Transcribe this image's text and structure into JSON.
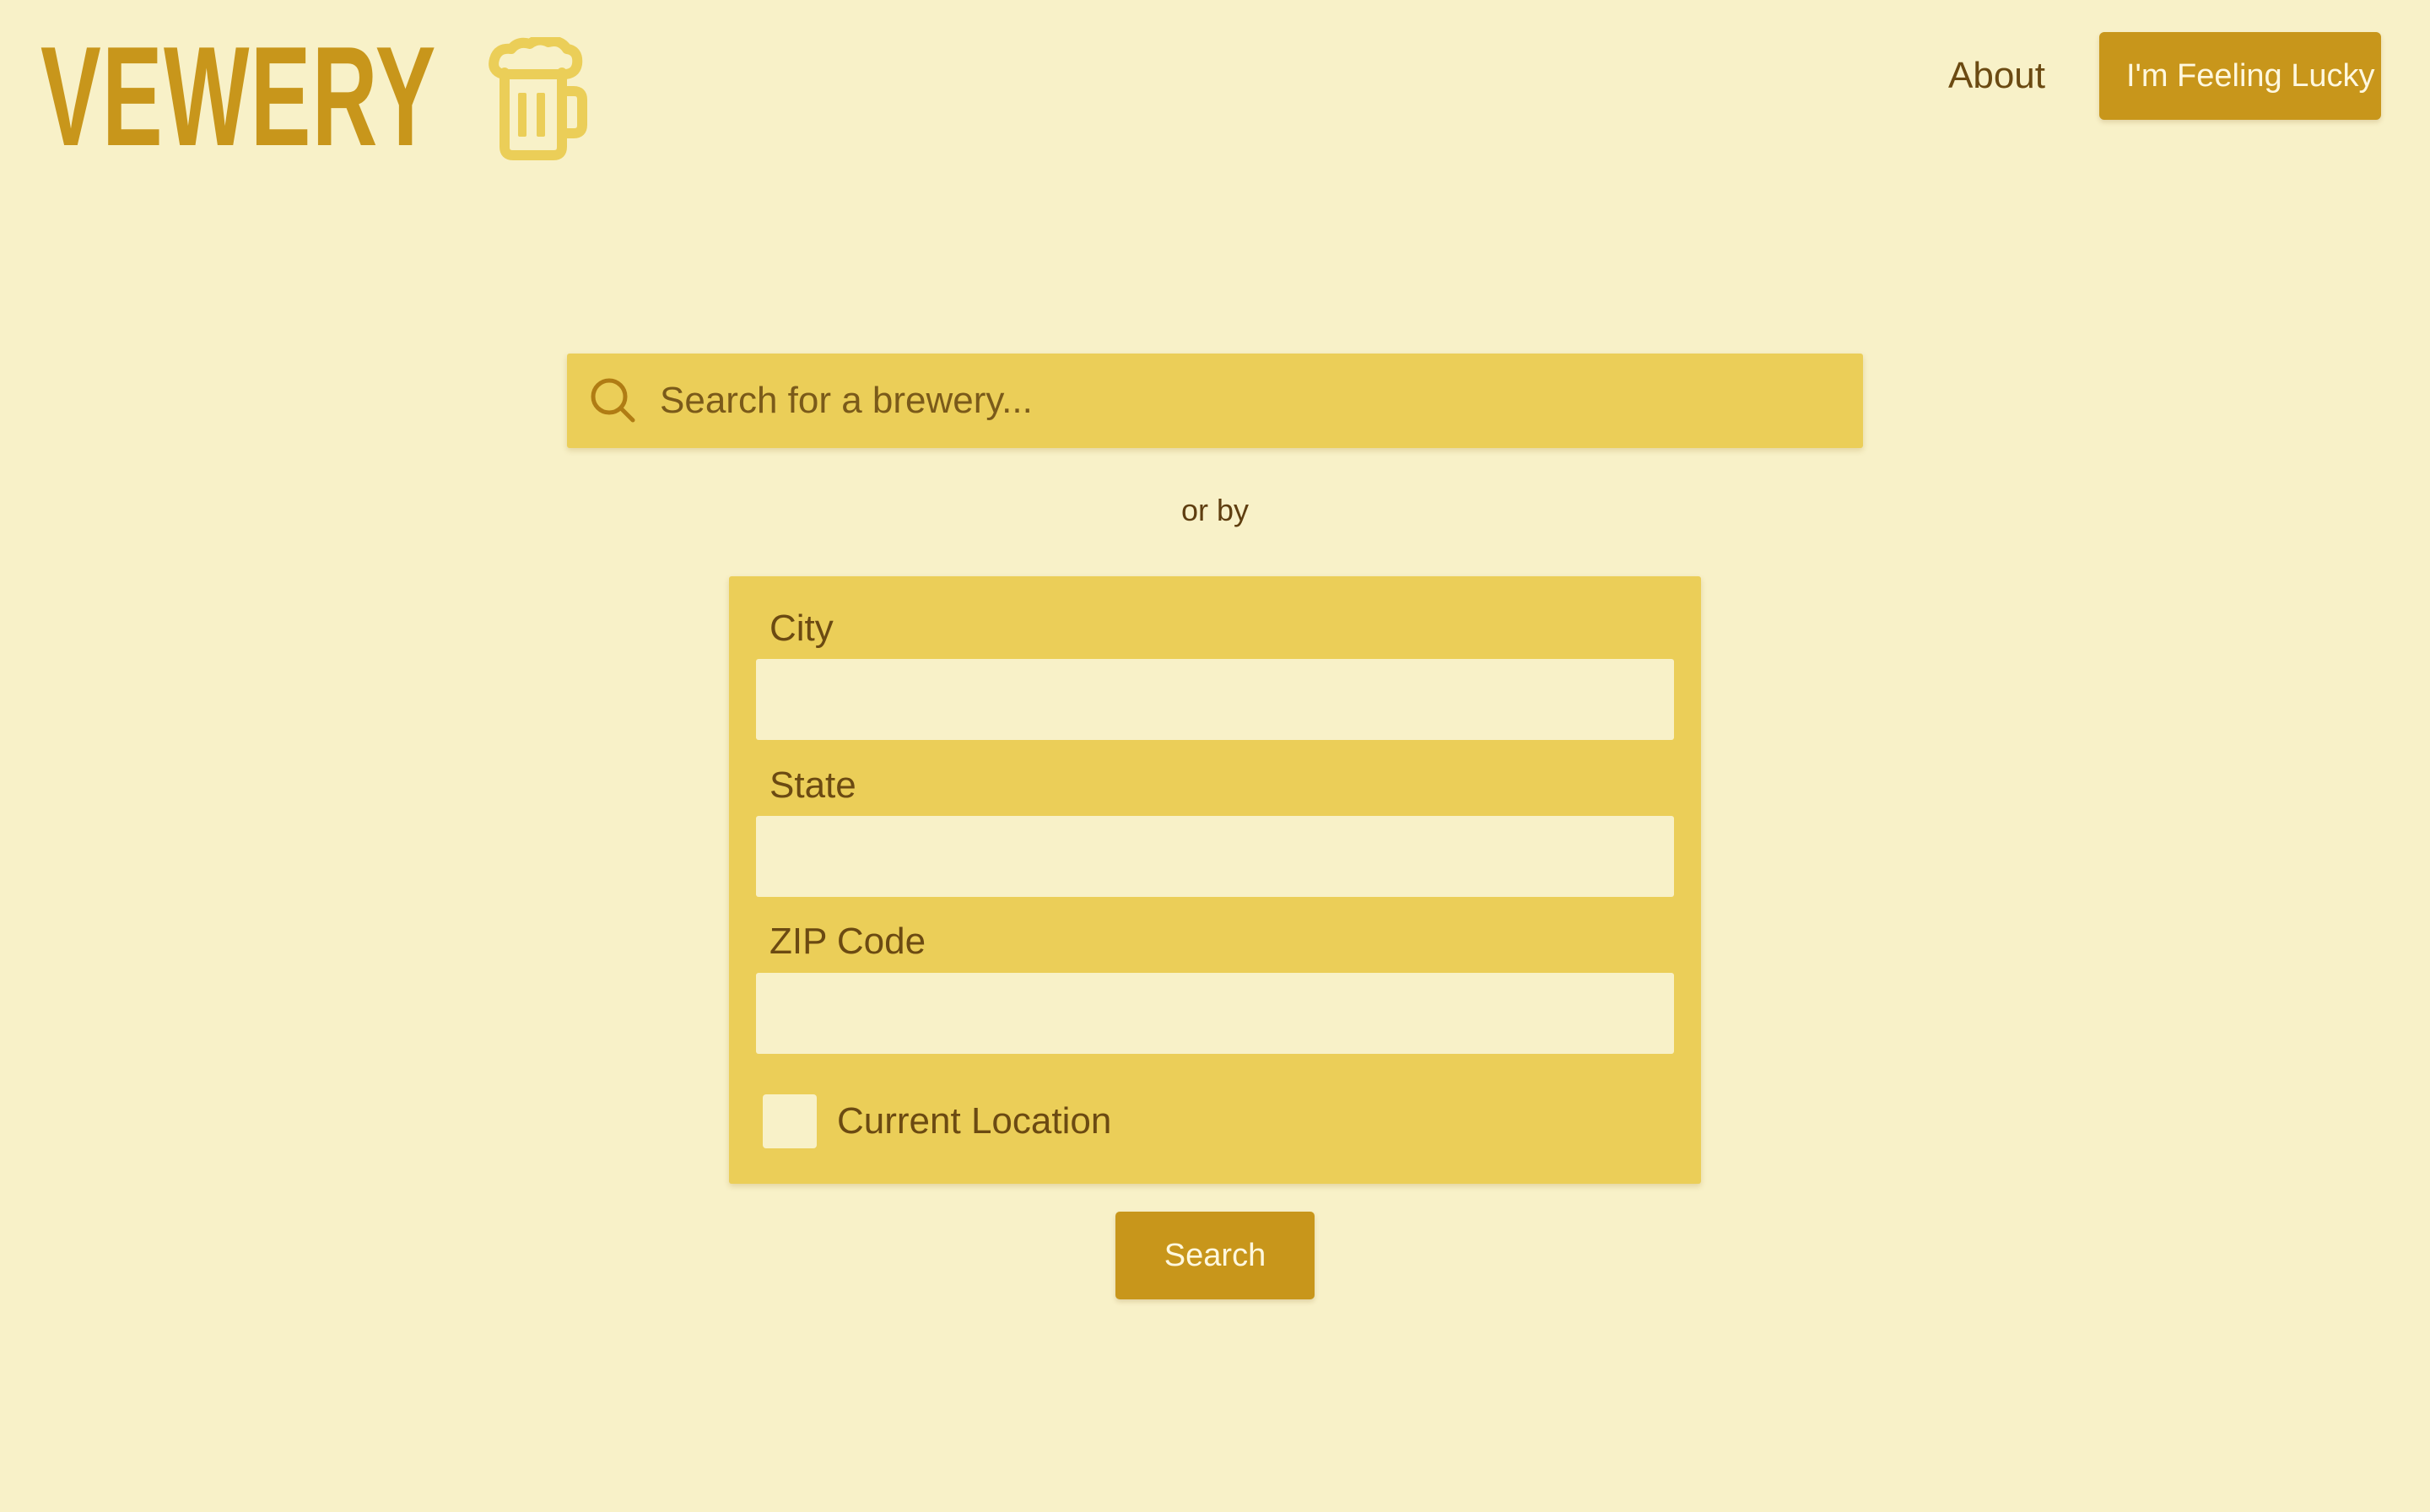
{
  "app": {
    "logo_text": "VEWERY",
    "logo_icon": "beer-mug-icon"
  },
  "nav": {
    "about_label": "About",
    "lucky_label": "I'm Feeling Lucky"
  },
  "search": {
    "placeholder": "Search for a brewery...",
    "value": "",
    "icon": "search-icon"
  },
  "divider_text": "or by",
  "location_form": {
    "city_label": "City",
    "city_value": "",
    "state_label": "State",
    "state_value": "",
    "zip_label": "ZIP Code",
    "zip_value": "",
    "current_location_label": "Current Location",
    "current_location_checked": false
  },
  "submit_label": "Search",
  "colors": {
    "background": "#f8f1c8",
    "panel": "#ebce58",
    "accent": "#c8961b",
    "text": "#6b4a12"
  }
}
